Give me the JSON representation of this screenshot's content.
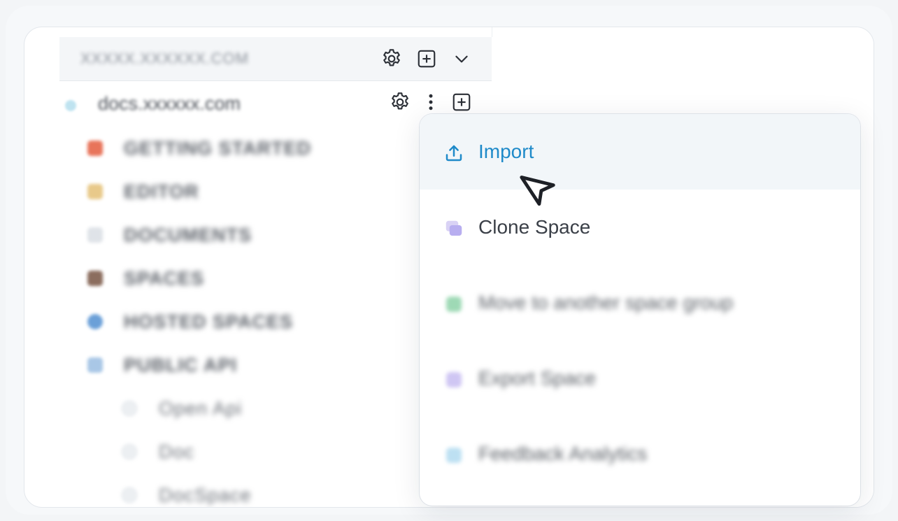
{
  "sidebar": {
    "org_name": "XXXXX.XXXXXX.COM",
    "space": {
      "name": "docs.xxxxxx.com"
    },
    "tree_items": [
      {
        "label": "GETTING STARTED",
        "color": "#e8745a"
      },
      {
        "label": "EDITOR",
        "color": "#e8c98a"
      },
      {
        "label": "DOCUMENTS",
        "color": "#e3e6ea"
      },
      {
        "label": "SPACES",
        "color": "#8b6d5e"
      },
      {
        "label": "HOSTED SPACES",
        "color": "#6ba0d8"
      },
      {
        "label": "PUBLIC API",
        "color": "#a9c7e6"
      }
    ],
    "sub_items": [
      {
        "label": "Open Api"
      },
      {
        "label": "Doc"
      },
      {
        "label": "DocSpace"
      }
    ]
  },
  "menu": {
    "import_label": "Import",
    "clone_label": "Clone Space",
    "move_label": "Move to another space group",
    "export_label": "Export Space",
    "feedback_label": "Feedback Analytics",
    "import_icon": "upload-icon",
    "accent_color": "#1f8ac9"
  }
}
